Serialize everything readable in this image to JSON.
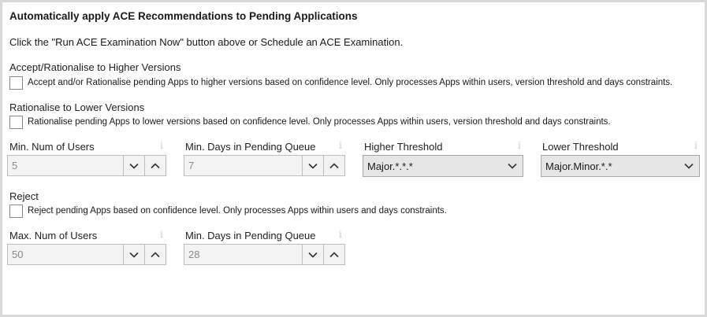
{
  "section": {
    "title": "Automatically apply ACE Recommendations to Pending Applications",
    "instruction": "Click the \"Run ACE Examination Now\" button above or Schedule an ACE Examination."
  },
  "higher": {
    "heading": "Accept/Rationalise to Higher Versions",
    "checkbox_label": "Accept and/or Rationalise pending Apps to higher versions based on confidence level. Only processes Apps within users, version threshold and days constraints.",
    "checked": false
  },
  "lower": {
    "heading": "Rationalise to Lower Versions",
    "checkbox_label": "Rationalise pending Apps to lower versions based on confidence level. Only processes Apps within users, version threshold and days constraints.",
    "checked": false
  },
  "fields": {
    "min_users": {
      "label": "Min. Num of Users",
      "value": "5"
    },
    "min_days": {
      "label": "Min. Days in Pending Queue",
      "value": "7"
    },
    "higher_threshold": {
      "label": "Higher Threshold",
      "value": "Major.*.*.*"
    },
    "lower_threshold": {
      "label": "Lower Threshold",
      "value": "Major.Minor.*.*"
    }
  },
  "reject": {
    "heading": "Reject",
    "checkbox_label": "Reject pending Apps based on confidence level. Only processes Apps within users and days constraints.",
    "checked": false,
    "max_users": {
      "label": "Max. Num of Users",
      "value": "50"
    },
    "min_days": {
      "label": "Min. Days in Pending Queue",
      "value": "28"
    }
  },
  "icons": {
    "info": "i",
    "spin_down": "chevron-down-icon",
    "spin_up": "chevron-up-icon",
    "dropdown": "chevron-down-icon"
  },
  "colors": {
    "frame_border": "#d9d9d9",
    "disabled_field_bg": "#f3f3f3",
    "combo_bg": "#e6e6e6",
    "info_icon": "#c8c8c8"
  }
}
